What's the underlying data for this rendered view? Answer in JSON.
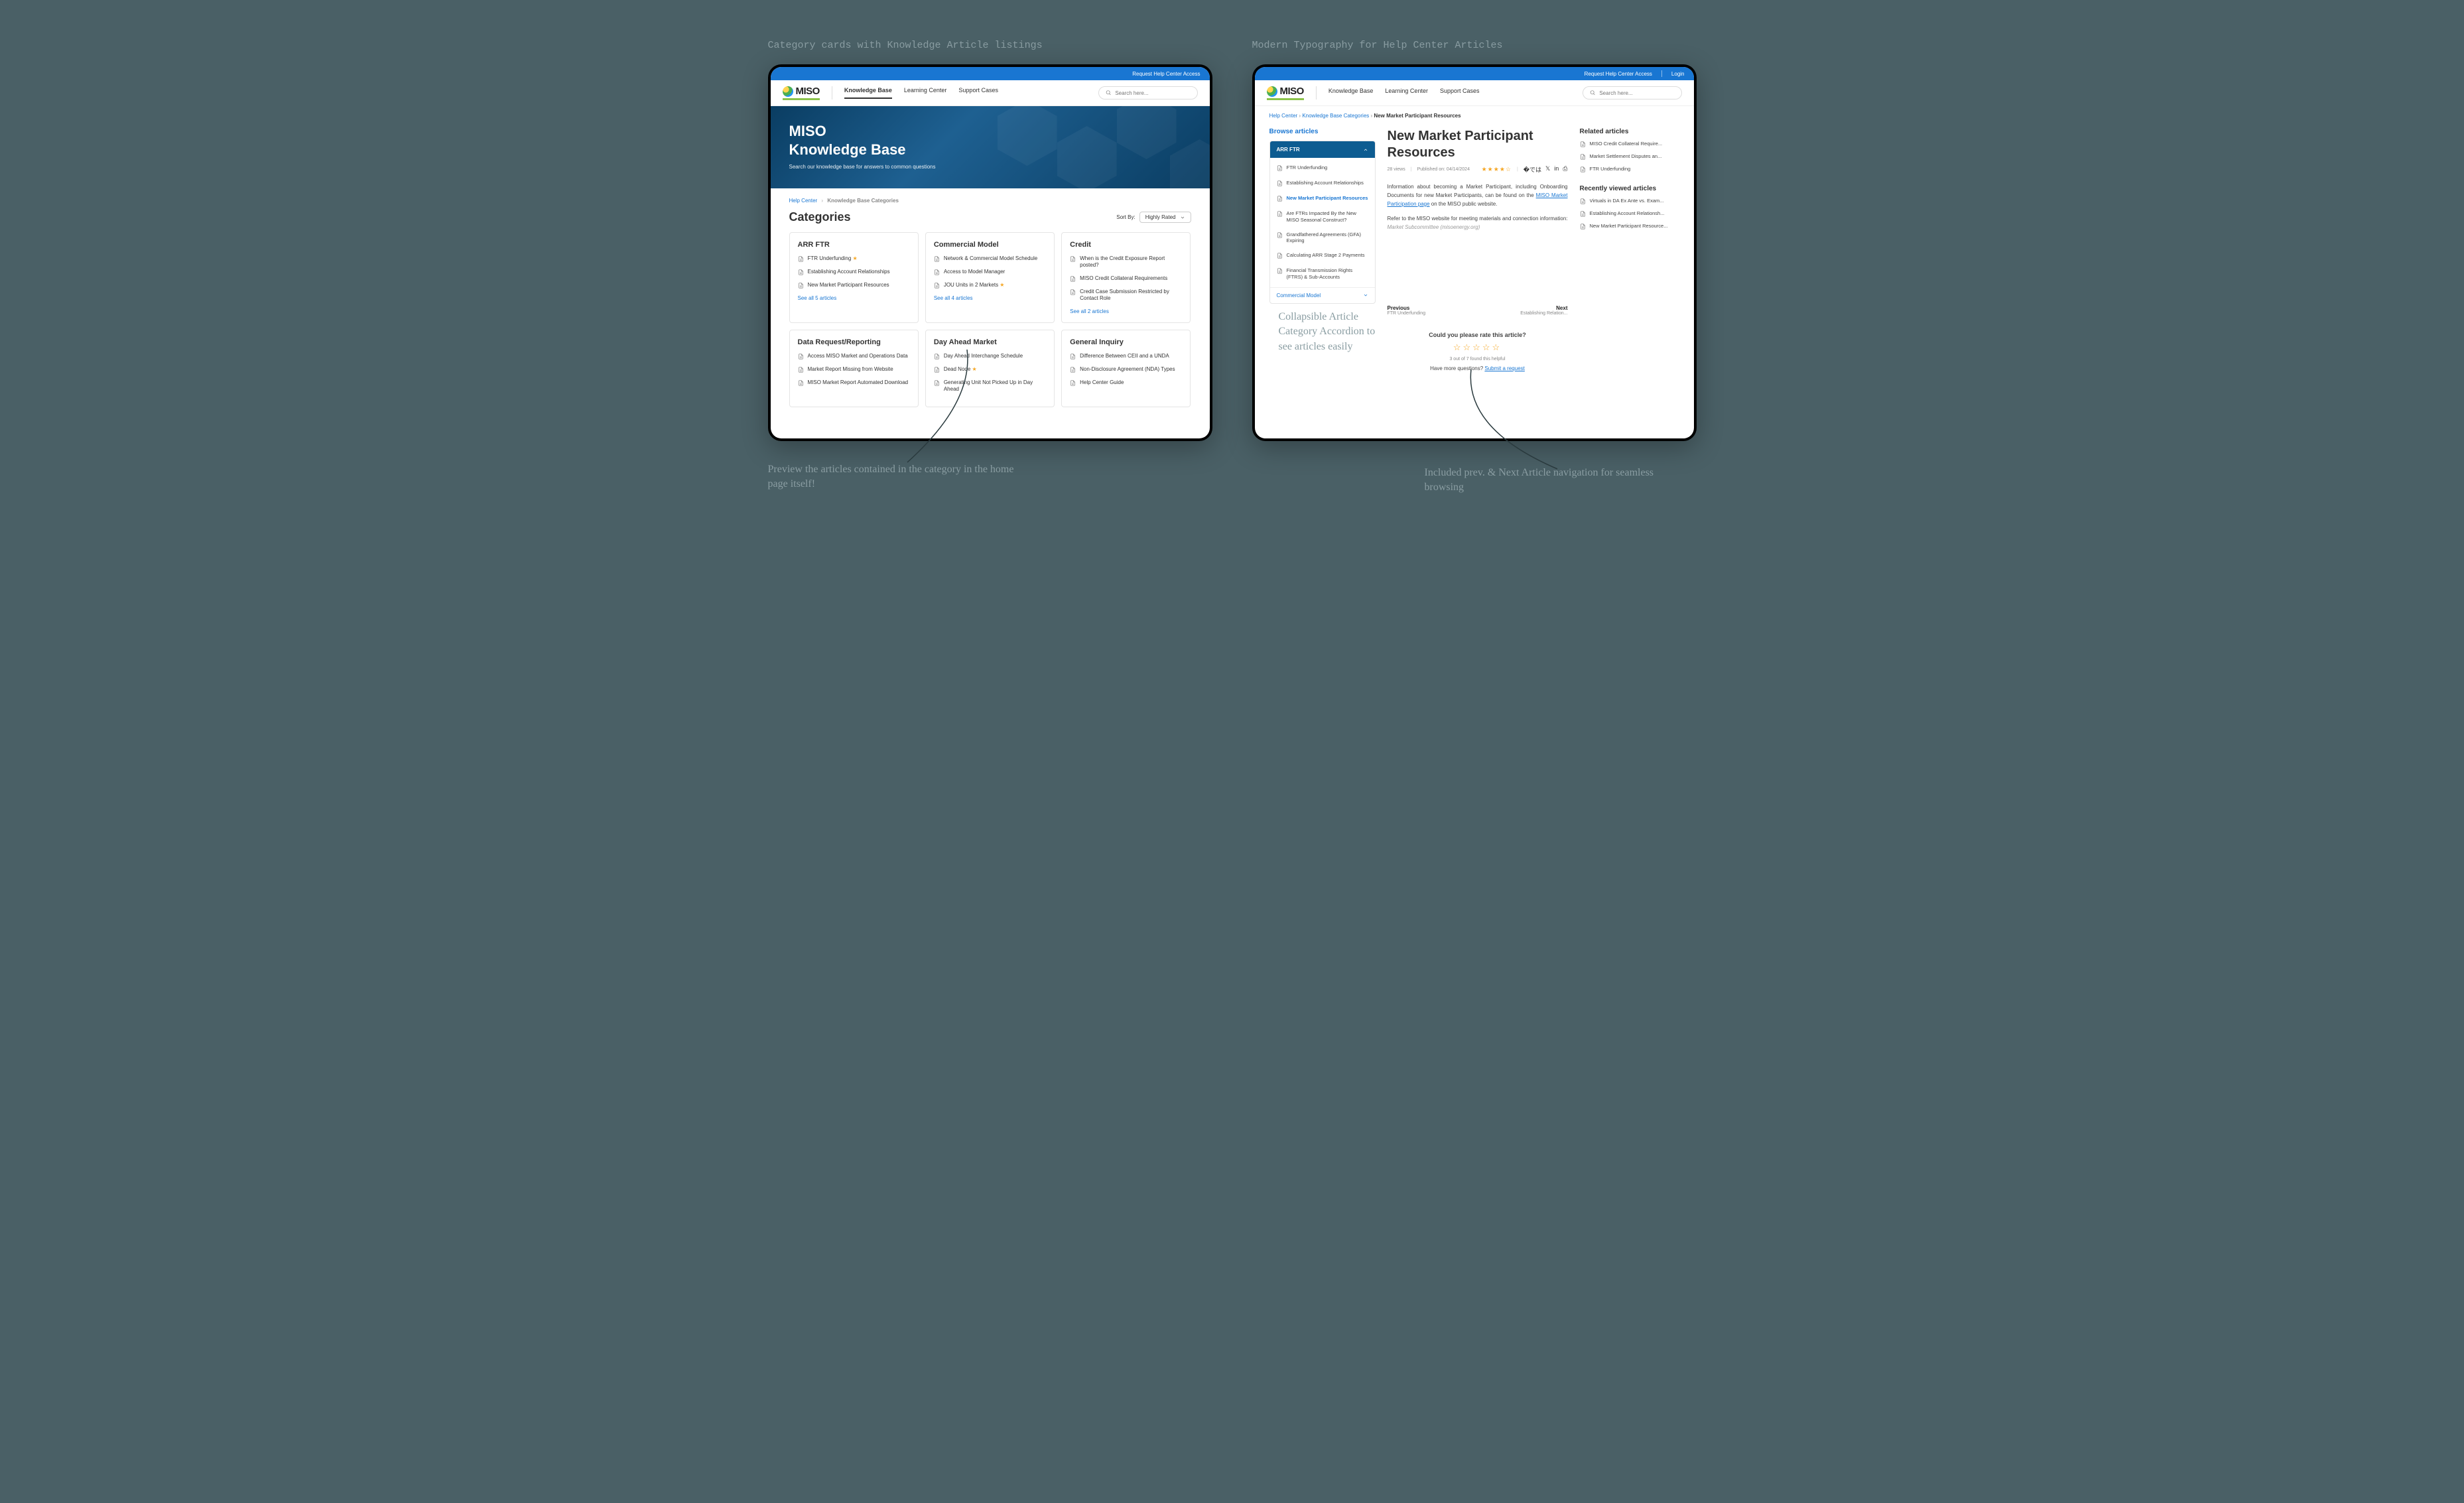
{
  "captions": {
    "left": "Category cards with Knowledge Article listings",
    "right": "Modern Typography for Help Center Articles"
  },
  "topbar": {
    "request": "Request Help Center Access",
    "login": "Login"
  },
  "logo": "MISO",
  "nav": [
    "Knowledge Base",
    "Learning Center",
    "Support Cases"
  ],
  "search_placeholder": "Search here...",
  "hero": {
    "title1": "MISO",
    "title2": "Knowledge Base",
    "subtitle": "Search our knowledge base for answers to common questions"
  },
  "breadcrumb_left": {
    "a": "Help Center",
    "b": "Knowledge Base Categories"
  },
  "cats_heading": "Categories",
  "sort_label": "Sort By:",
  "sort_value": "Highly Rated",
  "cards": [
    {
      "title": "ARR FTR",
      "items": [
        {
          "t": "FTR Underfunding",
          "star": true
        },
        {
          "t": "Establishing Account Relationships"
        },
        {
          "t": "New Market Participant Resources"
        }
      ],
      "see": "See all 5 articles"
    },
    {
      "title": "Commercial Model",
      "items": [
        {
          "t": "Network & Commercial Model Schedule"
        },
        {
          "t": "Access to Model Manager"
        },
        {
          "t": "JOU Units in 2 Markets",
          "star": true
        }
      ],
      "see": "See all 4 articles"
    },
    {
      "title": "Credit",
      "items": [
        {
          "t": "When is the Credit Exposure Report posted?"
        },
        {
          "t": "MISO Credit Collateral Requirements"
        },
        {
          "t": "Credit Case Submission Restricted by Contact Role"
        }
      ],
      "see": "See all 2 articles"
    },
    {
      "title": "Data Request/Reporting",
      "items": [
        {
          "t": "Access MISO Market and Operations Data"
        },
        {
          "t": "Market Report Missing from Website"
        },
        {
          "t": "MISO Market Report Automated Download"
        }
      ]
    },
    {
      "title": "Day Ahead Market",
      "items": [
        {
          "t": "Day Ahead Interchange Schedule"
        },
        {
          "t": "Dead Node",
          "star": true
        },
        {
          "t": "Generating Unit Not Picked Up in Day Ahead"
        }
      ]
    },
    {
      "title": "General Inquiry",
      "items": [
        {
          "t": "Difference Between CEII and a UNDA"
        },
        {
          "t": "Non-Disclosure Agreement (NDA) Types"
        },
        {
          "t": "Help Center Guide"
        }
      ]
    }
  ],
  "breadcrumb_right": {
    "a": "Help Center",
    "b": "Knowledge Base Categories",
    "c": "New Market Participant Resources"
  },
  "browse": "Browse articles",
  "accordion": {
    "header": "ARR FTR",
    "items": [
      "FTR Underfunding",
      "Establishing Account Relationships",
      "New Market Participant Resources",
      "Are FTRs Impacted By the New MISO Seasonal Construct?",
      "Grandfathered Agreements (GFA) Expiring",
      "Calculating ARR Stage 2 Payments",
      "Financial Transmission Rights (FTRS) & Sub-Accounts"
    ],
    "active_index": 2,
    "footer": "Commercial Model"
  },
  "article": {
    "title": "New Market Participant Resources",
    "views": "28 views",
    "published": "Published on: 04/14/2024",
    "stars": "★★★★☆",
    "body_p1_a": "Information about becoming a Market Participant, including Onboarding Documents for new Market Participants, can be found on the ",
    "body_p1_link": "MISO Market Participation page",
    "body_p1_b": " on the MISO public website.",
    "body_p2_a": "Refer to the MISO website for meeting materials and connection information: ",
    "body_p2_muted": "Market Subcommittee (misoenergy.org)"
  },
  "prevnext": {
    "prev_label": "Previous",
    "prev_title": "FTR Underfunding",
    "next_label": "Next",
    "next_title": "Establishing Relation..."
  },
  "rate": {
    "q": "Could you please rate this article?",
    "stars": "☆☆☆☆☆",
    "helpful": "3 out of 7 found this helpful",
    "more": "Have more questions? ",
    "submit": "Submit a request"
  },
  "related": {
    "title": "Related articles",
    "items": [
      "MISO Credit Collateral Require...",
      "Market Settlement Disputes an...",
      "FTR Underfunding"
    ]
  },
  "recent": {
    "title": "Recently viewed articles",
    "items": [
      "Virtuals in DA Ex Ante vs. Exam...",
      "Establishing Account Relationsh...",
      "New Market Participant Resource..."
    ]
  },
  "annotations": {
    "preview": "Preview the articles contained in the category in the home page itself!",
    "accordion": "Collapsible Article Category Accordion to see articles easily",
    "prevnext": "Included prev. & Next Article navigation for seamless browsing"
  }
}
